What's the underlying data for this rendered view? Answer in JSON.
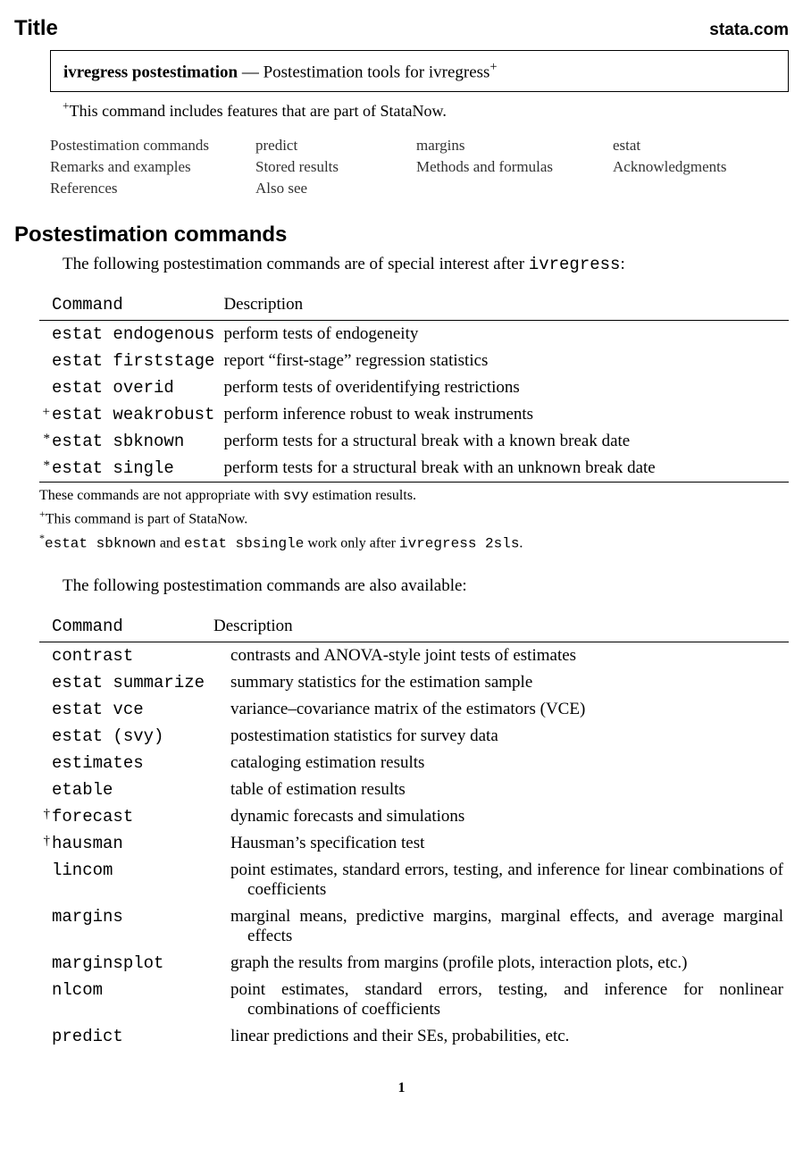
{
  "header": {
    "title": "Title",
    "brand": "stata.com"
  },
  "box": {
    "cmd": "ivregress postestimation",
    "sep": "—",
    "desc": "Postestimation tools for ivregress",
    "sup": "+"
  },
  "footnote": {
    "sup": "+",
    "text": "This command includes features that are part of StataNow."
  },
  "nav": [
    "Postestimation commands",
    "predict",
    "margins",
    "estat",
    "Remarks and examples",
    "Stored results",
    "Methods and formulas",
    "Acknowledgments",
    "References",
    "Also see",
    "",
    ""
  ],
  "section_heading": "Postestimation commands",
  "intro1_pre": "The following postestimation commands are of special interest after ",
  "intro1_cmd": "ivregress",
  "intro1_post": ":",
  "t_hdr_cmd": "Command",
  "t_hdr_desc": "Description",
  "table1": [
    {
      "mark": "",
      "cmd": "estat endogenous",
      "desc": "perform tests of endogeneity"
    },
    {
      "mark": "",
      "cmd": "estat firststage",
      "desc": "report “first-stage” regression statistics"
    },
    {
      "mark": "",
      "cmd": "estat overid",
      "desc": "perform tests of overidentifying restrictions"
    },
    {
      "mark": "+",
      "cmd": "estat weakrobust",
      "desc": "perform inference robust to weak instruments"
    },
    {
      "mark": "*",
      "cmd": "estat sbknown",
      "desc": "perform tests for a structural break with a known break date"
    },
    {
      "mark": "*",
      "cmd": "estat single",
      "desc": "perform tests for a structural break with an unknown break date"
    }
  ],
  "notes1": {
    "n1_a": "These commands are not appropriate with ",
    "n1_b": "svy",
    "n1_c": " estimation results.",
    "n2_sup": "+",
    "n2": "This command is part of StataNow.",
    "n3_sup": "*",
    "n3_a": "estat sbknown",
    "n3_b": " and ",
    "n3_c": "estat sbsingle",
    "n3_d": " work only after ",
    "n3_e": "ivregress 2sls",
    "n3_f": "."
  },
  "intro2": "The following postestimation commands are also available:",
  "table2": [
    {
      "mark": "",
      "cmd": "contrast",
      "desc_pre": "contrasts and ",
      "desc_sc": "ANOVA",
      "desc_post": "-style joint tests of estimates"
    },
    {
      "mark": "",
      "cmd": "estat summarize",
      "desc": "summary statistics for the estimation sample"
    },
    {
      "mark": "",
      "cmd": "estat vce",
      "desc": "variance–covariance matrix of the estimators (VCE)"
    },
    {
      "mark": "",
      "cmd": "estat (svy)",
      "desc": "postestimation statistics for survey data"
    },
    {
      "mark": "",
      "cmd": "estimates",
      "desc": "cataloging estimation results"
    },
    {
      "mark": "",
      "cmd": "etable",
      "desc": "table of estimation results"
    },
    {
      "mark": "†",
      "cmd": "forecast",
      "desc": "dynamic forecasts and simulations"
    },
    {
      "mark": "†",
      "cmd": "hausman",
      "desc": "Hausman’s specification test"
    },
    {
      "mark": "",
      "cmd": "lincom",
      "desc": "point estimates, standard errors, testing, and inference for linear combinations of coefficients"
    },
    {
      "mark": "",
      "cmd": "margins",
      "desc": "marginal means, predictive margins, marginal effects, and average marginal effects"
    },
    {
      "mark": "",
      "cmd": "marginsplot",
      "desc": "graph the results from margins (profile plots, interaction plots, etc.)"
    },
    {
      "mark": "",
      "cmd": "nlcom",
      "desc": "point estimates, standard errors, testing, and inference for nonlinear combinations of coefficients"
    },
    {
      "mark": "",
      "cmd": "predict",
      "desc": "linear predictions and their SEs, probabilities, etc."
    }
  ],
  "page_number": "1"
}
